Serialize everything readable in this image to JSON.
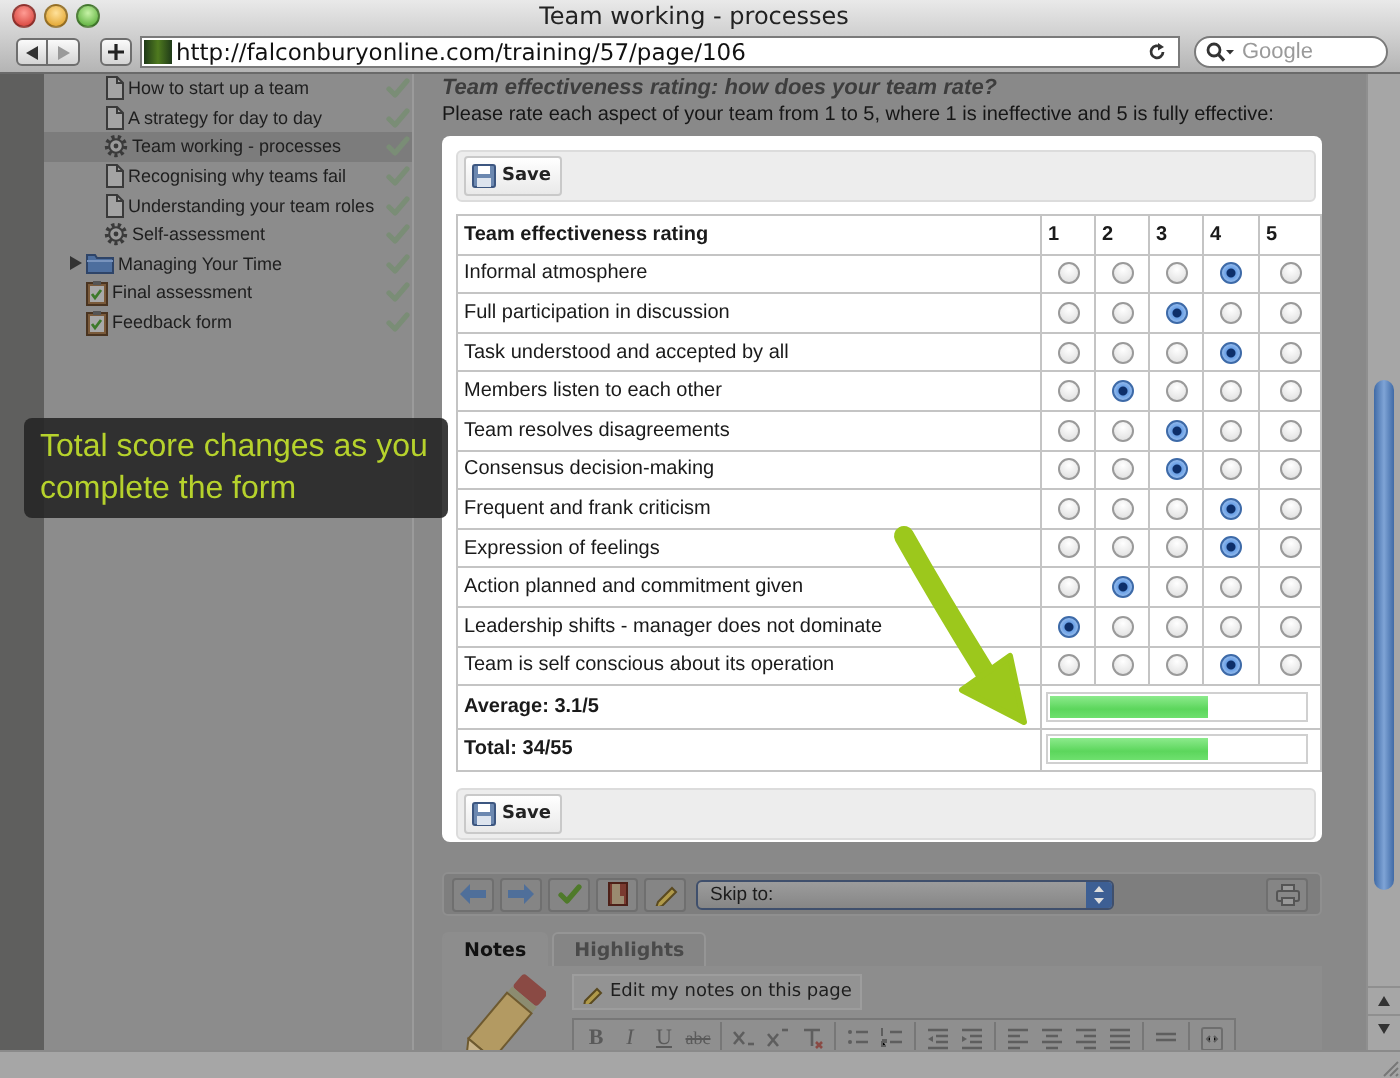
{
  "window": {
    "title": "Team working - processes"
  },
  "browser": {
    "url": "http://falconburyonline.com/training/57/page/106",
    "search": {
      "placeholder": "Google"
    }
  },
  "sidebar": {
    "module_pages": [
      {
        "label": "How to start up a team",
        "kind": "page",
        "selected": false
      },
      {
        "label": "A strategy for day to day",
        "kind": "page",
        "selected": false
      },
      {
        "label": "Team working - processes",
        "kind": "activity",
        "selected": true
      },
      {
        "label": "Recognising why teams fail",
        "kind": "page",
        "selected": false
      },
      {
        "label": "Understanding your team roles",
        "kind": "page",
        "selected": false
      },
      {
        "label": "Self-assessment",
        "kind": "activity",
        "selected": false
      }
    ],
    "items": [
      {
        "label": "Managing Your Time",
        "kind": "folder",
        "selected": false,
        "expanded": false
      },
      {
        "label": "Final assessment",
        "kind": "assessment",
        "selected": false
      },
      {
        "label": "Feedback form",
        "kind": "assessment",
        "selected": false
      }
    ]
  },
  "content": {
    "heading": "Team effectiveness rating: how does your team rate?",
    "instructions": "Please rate each aspect of your team from 1 to 5, where 1 is ineffective and 5 is fully effective:"
  },
  "rating_form": {
    "top_save": "Save",
    "bottom_save": "Save",
    "table": {
      "columns": [
        "Team effectiveness rating",
        "1",
        "2",
        "3",
        "4",
        "5"
      ],
      "rows": [
        {
          "label": "Informal atmosphere",
          "selected": [
            false,
            false,
            false,
            true,
            false
          ]
        },
        {
          "label": "Full participation in discussion",
          "selected": [
            false,
            false,
            true,
            false,
            false
          ]
        },
        {
          "label": "Task understood and accepted by all",
          "selected": [
            false,
            false,
            false,
            true,
            false
          ]
        },
        {
          "label": "Members listen to each other",
          "selected": [
            false,
            true,
            false,
            false,
            false
          ]
        },
        {
          "label": "Team resolves disagreements",
          "selected": [
            false,
            false,
            true,
            false,
            false
          ]
        },
        {
          "label": "Consensus decision-making",
          "selected": [
            false,
            false,
            true,
            false,
            false
          ]
        },
        {
          "label": "Frequent and frank criticism",
          "selected": [
            false,
            false,
            false,
            true,
            false
          ]
        },
        {
          "label": "Expression of feelings",
          "selected": [
            false,
            false,
            false,
            true,
            false
          ]
        },
        {
          "label": "Action planned and commitment given",
          "selected": [
            false,
            true,
            false,
            false,
            false
          ]
        },
        {
          "label": "Leadership shifts - manager does not dominate",
          "selected": [
            true,
            false,
            false,
            false,
            false
          ]
        },
        {
          "label": "Team is self conscious about its operation",
          "selected": [
            false,
            false,
            false,
            true,
            false
          ]
        }
      ],
      "summary": [
        {
          "label": "Average: 3.1/5",
          "level": 0.62
        },
        {
          "label": "Total: 34/55",
          "level": 0.62
        }
      ]
    }
  },
  "lesson_toolbar": {
    "skip_to": "Skip to:"
  },
  "notes_tabs": [
    {
      "label": "Notes",
      "selected": true
    },
    {
      "label": "Highlights",
      "selected": false
    }
  ],
  "notes": {
    "edit_button": "Edit my notes on this page",
    "text_buttons": [
      {
        "label": "B",
        "kind": "bold"
      },
      {
        "label": "I",
        "kind": "italic"
      },
      {
        "label": "U",
        "kind": "underline"
      },
      {
        "label": "abc",
        "kind": "strike"
      }
    ]
  },
  "callout": {
    "text": "Total score changes as you complete the form"
  }
}
